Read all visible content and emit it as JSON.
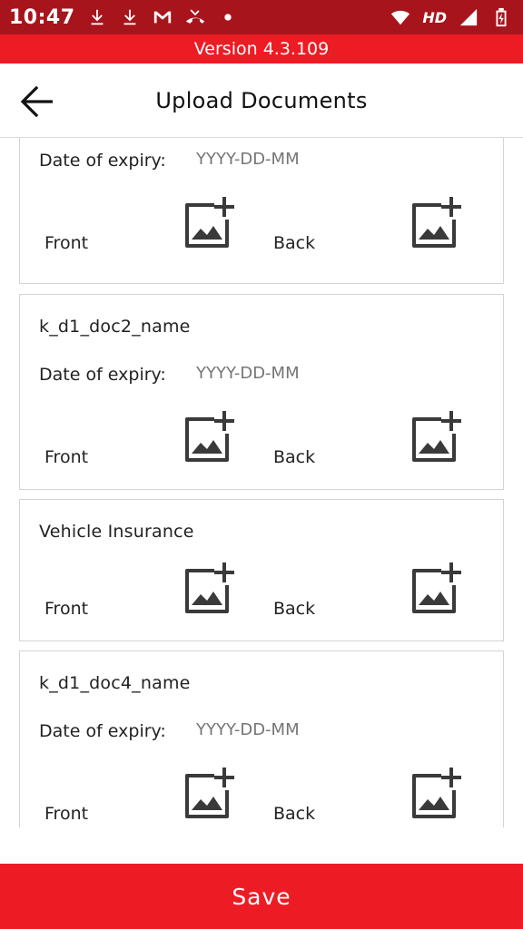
{
  "status_bar": {
    "time": "10:47",
    "network": "HD",
    "icons": [
      "download-icon",
      "download-icon",
      "gmail-icon",
      "missed-call-icon",
      "dot-icon",
      "wifi-icon",
      "signal-icon",
      "battery-icon"
    ]
  },
  "version_bar": {
    "text": "Version 4.3.109"
  },
  "header": {
    "title": "Upload Documents",
    "back_icon": "arrow-left-icon"
  },
  "documents": [
    {
      "title": "",
      "expiry_label": "Date of expiry:",
      "expiry_placeholder": "YYYY-DD-MM",
      "front_label": "Front",
      "back_label": "Back"
    },
    {
      "title": "k_d1_doc2_name",
      "expiry_label": "Date of expiry:",
      "expiry_placeholder": "YYYY-DD-MM",
      "front_label": "Front",
      "back_label": "Back"
    },
    {
      "title": "Vehicle Insurance",
      "front_label": "Front",
      "back_label": "Back"
    },
    {
      "title": "k_d1_doc4_name",
      "expiry_label": "Date of expiry:",
      "expiry_placeholder": "YYYY-DD-MM",
      "front_label": "Front",
      "back_label": "Back"
    }
  ],
  "save_button": {
    "label": "Save"
  },
  "colors": {
    "status_bar": "#a8141c",
    "accent": "#ed1c24",
    "icon": "#3a3a3a"
  }
}
